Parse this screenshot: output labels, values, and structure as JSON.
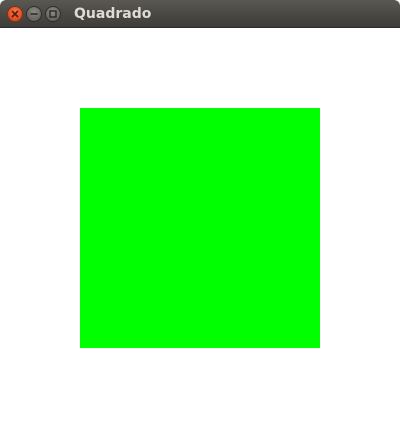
{
  "window": {
    "title": "Quadrado",
    "controls": {
      "close_icon": "close-icon",
      "minimize_icon": "minimize-icon",
      "maximize_icon": "maximize-icon"
    }
  },
  "canvas": {
    "background": "#ffffff",
    "square_color": "#00ff00"
  }
}
